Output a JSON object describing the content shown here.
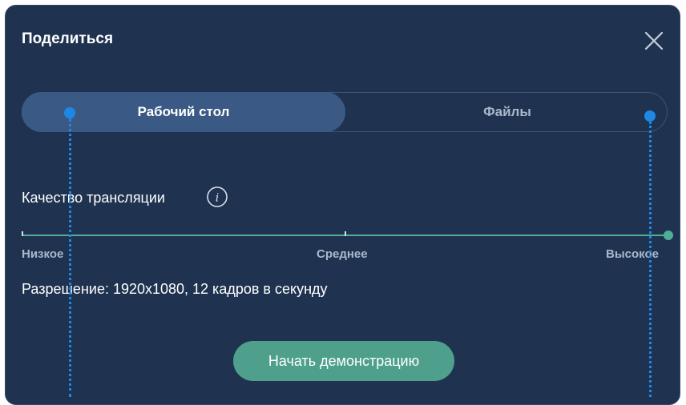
{
  "dialog": {
    "title": "Поделиться",
    "close_icon": "close-icon"
  },
  "tabs": [
    {
      "label": "Рабочий стол",
      "active": true
    },
    {
      "label": "Файлы",
      "active": false
    }
  ],
  "quality": {
    "label": "Качество трансляции",
    "info_icon": "info-icon",
    "levels": [
      "Низкое",
      "Среднее",
      "Высокое"
    ],
    "selected": "Высокое"
  },
  "resolution_text": "Разрешение: 1920x1080, 12 кадров в секунду",
  "start_button_label": "Начать демонстрацию",
  "colors": {
    "background": "#1f3350",
    "tab_active": "#3a5a85",
    "accent_green": "#4ea08d",
    "marker_blue": "#1e88e5"
  }
}
